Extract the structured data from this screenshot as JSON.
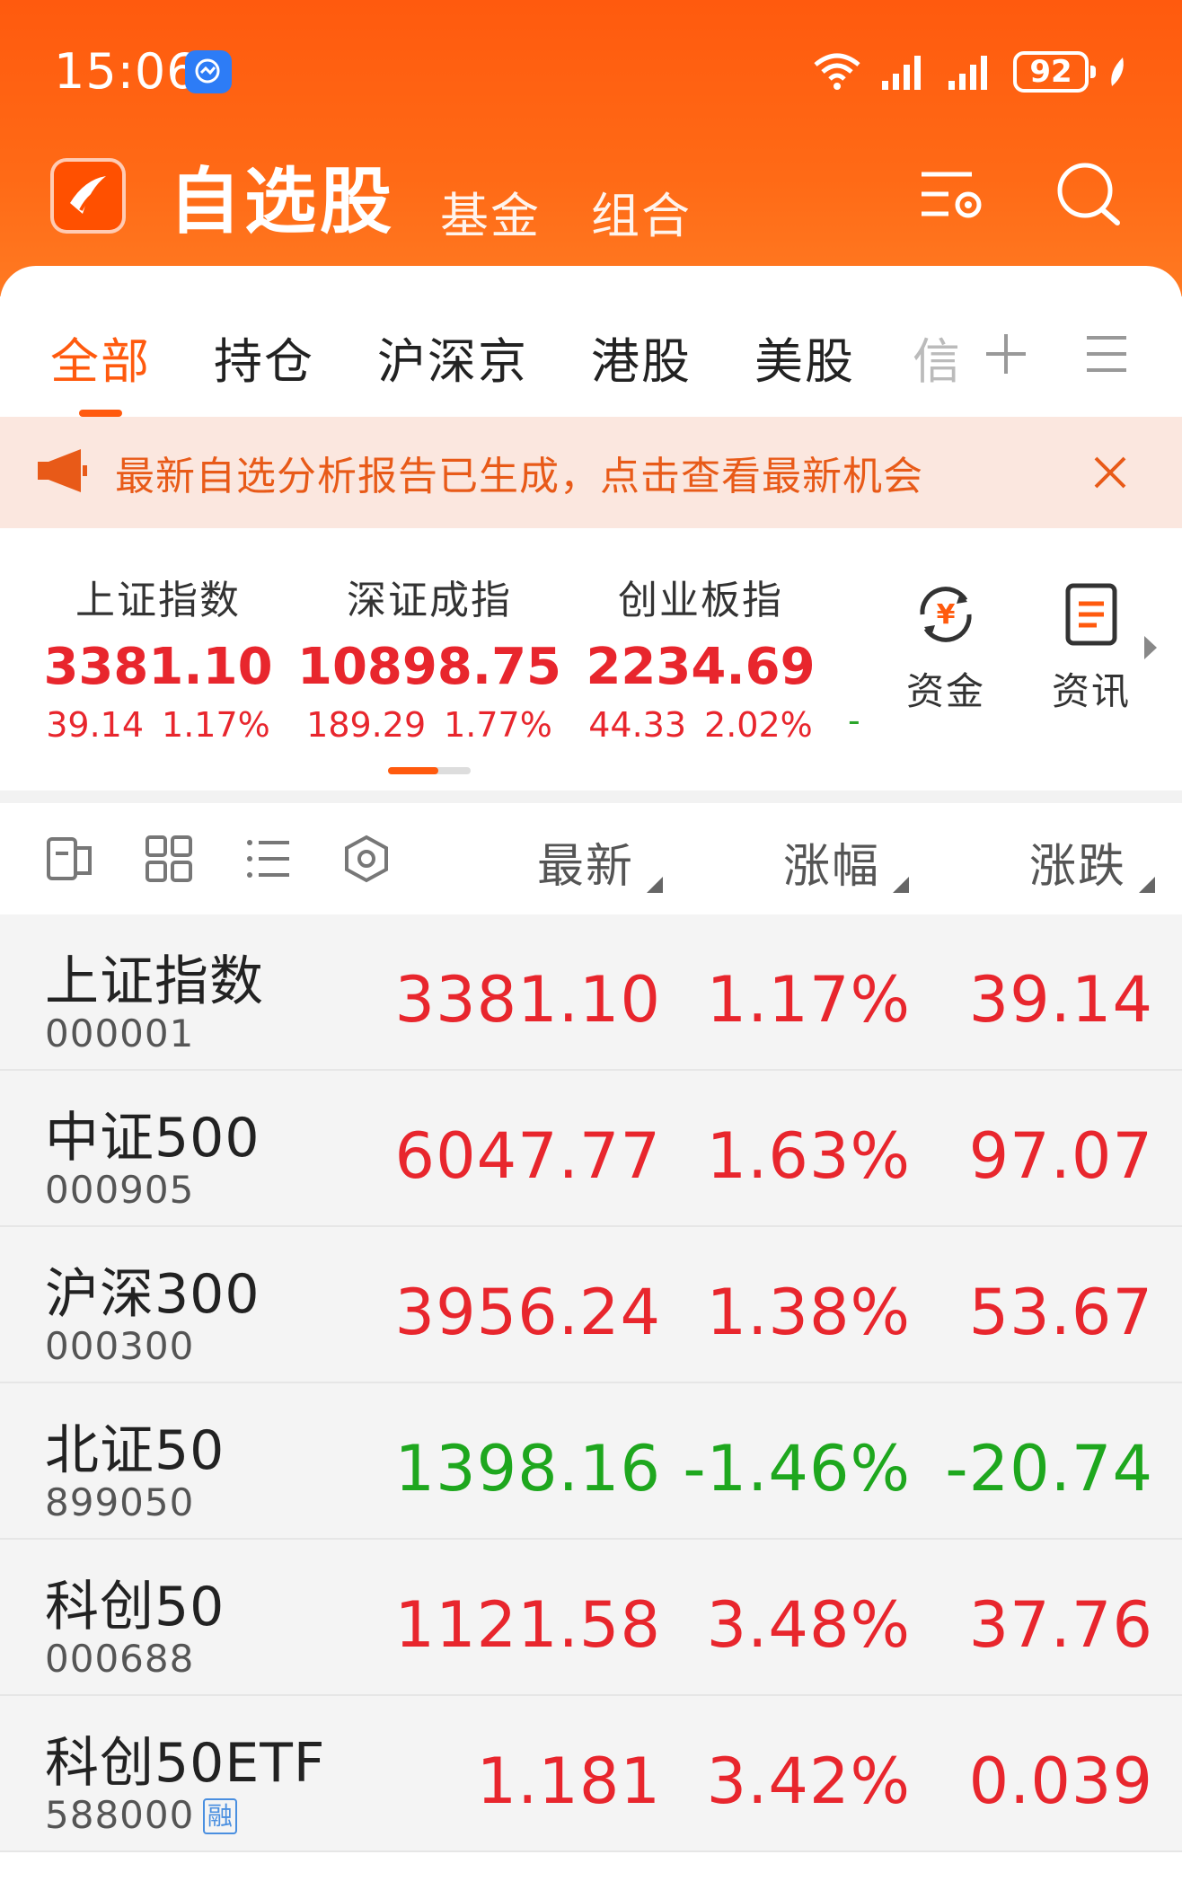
{
  "status_bar": {
    "time": "15:06",
    "battery": "92"
  },
  "header": {
    "main_tab": "自选股",
    "sub_tabs": [
      "基金",
      "组合"
    ],
    "icons": [
      "list-settings-icon",
      "search-icon"
    ]
  },
  "categories": {
    "tabs": [
      "全部",
      "持仓",
      "沪深京",
      "港股",
      "美股"
    ],
    "truncated_tab": "信",
    "active_index": 0
  },
  "banner": {
    "text": "最新自选分析报告已生成，点击查看最新机会"
  },
  "index_strip": {
    "indices": [
      {
        "name": "上证指数",
        "value": "3381.10",
        "change": "39.14",
        "pct": "1.17%"
      },
      {
        "name": "深证成指",
        "value": "10898.75",
        "change": "189.29",
        "pct": "1.77%"
      },
      {
        "name": "创业板指",
        "value": "2234.69",
        "change": "44.33",
        "pct": "2.02%"
      }
    ],
    "dash": "-",
    "tools": [
      {
        "label": "资金",
        "icon": "yuan-refresh-icon"
      },
      {
        "label": "资讯",
        "icon": "news-doc-icon"
      }
    ]
  },
  "table": {
    "columns": [
      "最新",
      "涨幅",
      "涨跌"
    ],
    "rows": [
      {
        "name": "上证指数",
        "code": "000001",
        "latest": "3381.10",
        "pct": "1.17%",
        "chg": "39.14",
        "trend": "up"
      },
      {
        "name": "中证500",
        "code": "000905",
        "latest": "6047.77",
        "pct": "1.63%",
        "chg": "97.07",
        "trend": "up"
      },
      {
        "name": "沪深300",
        "code": "000300",
        "latest": "3956.24",
        "pct": "1.38%",
        "chg": "53.67",
        "trend": "up"
      },
      {
        "name": "北证50",
        "code": "899050",
        "latest": "1398.16",
        "pct": "-1.46%",
        "chg": "-20.74",
        "trend": "down"
      },
      {
        "name": "科创50",
        "code": "000688",
        "latest": "1121.58",
        "pct": "3.48%",
        "chg": "37.76",
        "trend": "up"
      },
      {
        "name": "科创50ETF",
        "code": "588000",
        "tag": "融",
        "latest": "1.181",
        "pct": "3.42%",
        "chg": "0.039",
        "trend": "up"
      }
    ]
  },
  "colors": {
    "brand": "#ff5a0e",
    "up": "#e8262d",
    "down": "#1ea71e",
    "banner_bg": "#fbe7df"
  }
}
